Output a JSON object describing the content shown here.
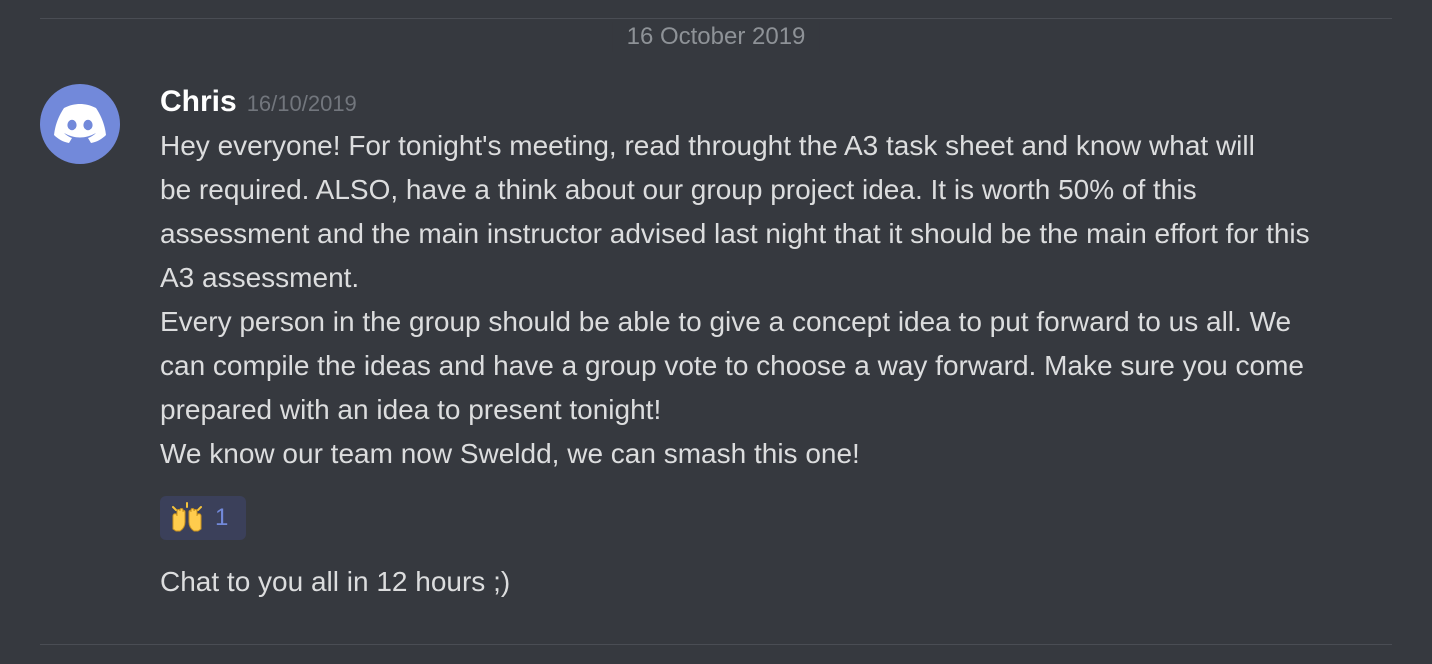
{
  "date_divider": "16 October 2019",
  "message": {
    "avatar_icon": "discord-logo-icon",
    "avatar_color": "#7289da",
    "username": "Chris",
    "timestamp": "16/10/2019",
    "lines": [
      "Hey everyone! For tonight's meeting, read throught the A3 task sheet and know what will",
      "be required. ALSO, have a think about our group project idea. It is worth 50% of this",
      "assessment and the main instructor advised last night that it should be the main effort for this",
      "A3 assessment.",
      "Every person in the group should be able to give a concept idea to put forward to us all. We",
      "can compile the ideas and have a group vote to choose a way forward. Make sure you come",
      "prepared with an idea to present tonight!",
      "We know our team now Sweldd, we can smash this one!"
    ]
  },
  "reaction": {
    "emoji_icon": "raised-hands-icon",
    "count": "1"
  },
  "followup_message": "Chat to you all in 12 hours ;)"
}
